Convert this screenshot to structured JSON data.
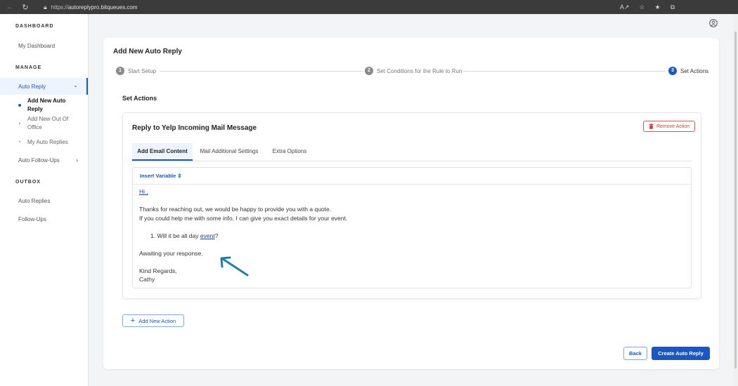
{
  "browser": {
    "url_prefix": "https://",
    "url_host": "autoreplypro.bitqueues.com"
  },
  "sidebar": {
    "sections": [
      {
        "title": "DASHBOARD"
      },
      {
        "title": "MANAGE"
      },
      {
        "title": "OUTBOX"
      }
    ],
    "dashboard_link": "My Dashboard",
    "auto_reply": "Auto Reply",
    "sub_items": [
      "Add New Auto Reply",
      "Add New Out Of Office",
      "My Auto Replies"
    ],
    "auto_follow_ups": "Auto Follow-Ups",
    "outbox_items": [
      "Auto Replies",
      "Follow-Ups"
    ]
  },
  "main": {
    "page_title": "Add New Auto Reply",
    "steps": [
      {
        "num": "1",
        "label": "Start Setup"
      },
      {
        "num": "2",
        "label": "Set Conditions for the Rule to Run"
      },
      {
        "num": "3",
        "label": "Set Actions"
      }
    ],
    "section_title": "Set Actions",
    "action": {
      "title": "Reply to Yelp Incoming Mail Message",
      "remove_label": "Remove Action",
      "tabs": [
        "Add Email Content",
        "Mail Additional Settings",
        "Extra Options"
      ],
      "insert_variable": "Insert Variable",
      "body": {
        "greeting": "Hi",
        "greeting_punct": " ,",
        "line1": "Thanks for reaching out, we would be happy to provide you with a quote.",
        "line2": "If you could help me with some info, I can give you exact details for your event.",
        "list_num": "1.",
        "list_text": "Will it be all day ",
        "list_link": "event",
        "list_end": "?",
        "awaiting": "Awaiting your response.",
        "regards": "Kind Regards,",
        "name": "Cathy"
      }
    },
    "add_action": "Add New Action",
    "back": "Back",
    "create": "Create Auto Reply"
  },
  "colors": {
    "primary": "#1a56c4",
    "danger": "#d43c3c",
    "annotation_arrow": "#1e7fa8"
  }
}
